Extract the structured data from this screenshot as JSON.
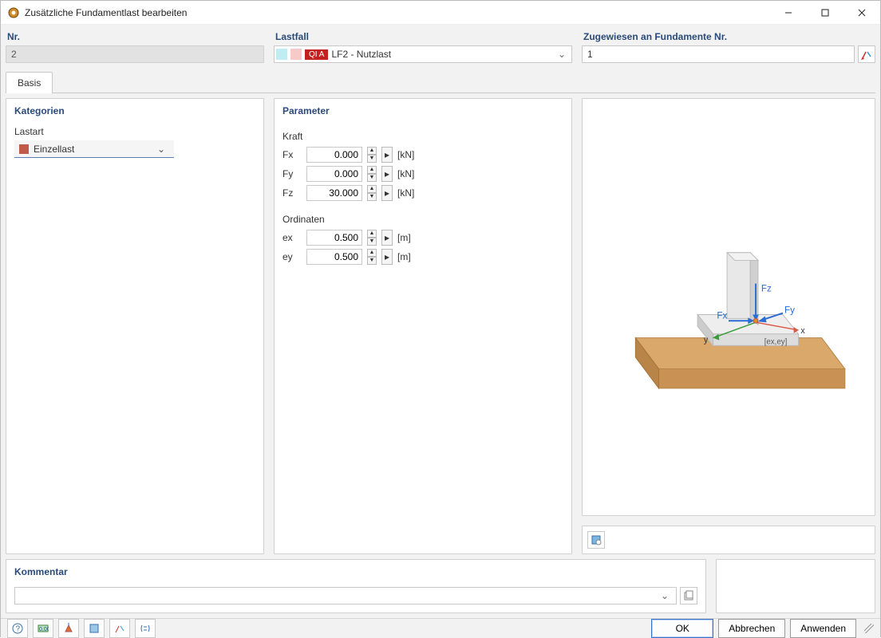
{
  "title": "Zusätzliche Fundamentlast bearbeiten",
  "top": {
    "nr_label": "Nr.",
    "nr_value": "2",
    "lastfall_label": "Lastfall",
    "lf_badge": "QI A",
    "lf_text": "LF2 - Nutzlast",
    "zug_label": "Zugewiesen an Fundamente Nr.",
    "zug_value": "1"
  },
  "tab": "Basis",
  "kategorien": {
    "title": "Kategorien",
    "lastart_label": "Lastart",
    "lastart_value": "Einzellast"
  },
  "parameter": {
    "title": "Parameter",
    "kraft_label": "Kraft",
    "force": [
      {
        "name": "Fx",
        "value": "0.000",
        "unit": "[kN]"
      },
      {
        "name": "Fy",
        "value": "0.000",
        "unit": "[kN]"
      },
      {
        "name": "Fz",
        "value": "30.000",
        "unit": "[kN]"
      }
    ],
    "ordinaten_label": "Ordinaten",
    "ord": [
      {
        "name": "ex",
        "value": "0.500",
        "unit": "[m]"
      },
      {
        "name": "ey",
        "value": "0.500",
        "unit": "[m]"
      }
    ]
  },
  "preview_labels": {
    "fz": "Fz",
    "fx": "Fx",
    "fy": "Fy",
    "y": "y",
    "x": "x",
    "exey": "[ex,ey]"
  },
  "kommentar_label": "Kommentar",
  "buttons": {
    "ok": "OK",
    "cancel": "Abbrechen",
    "apply": "Anwenden"
  }
}
